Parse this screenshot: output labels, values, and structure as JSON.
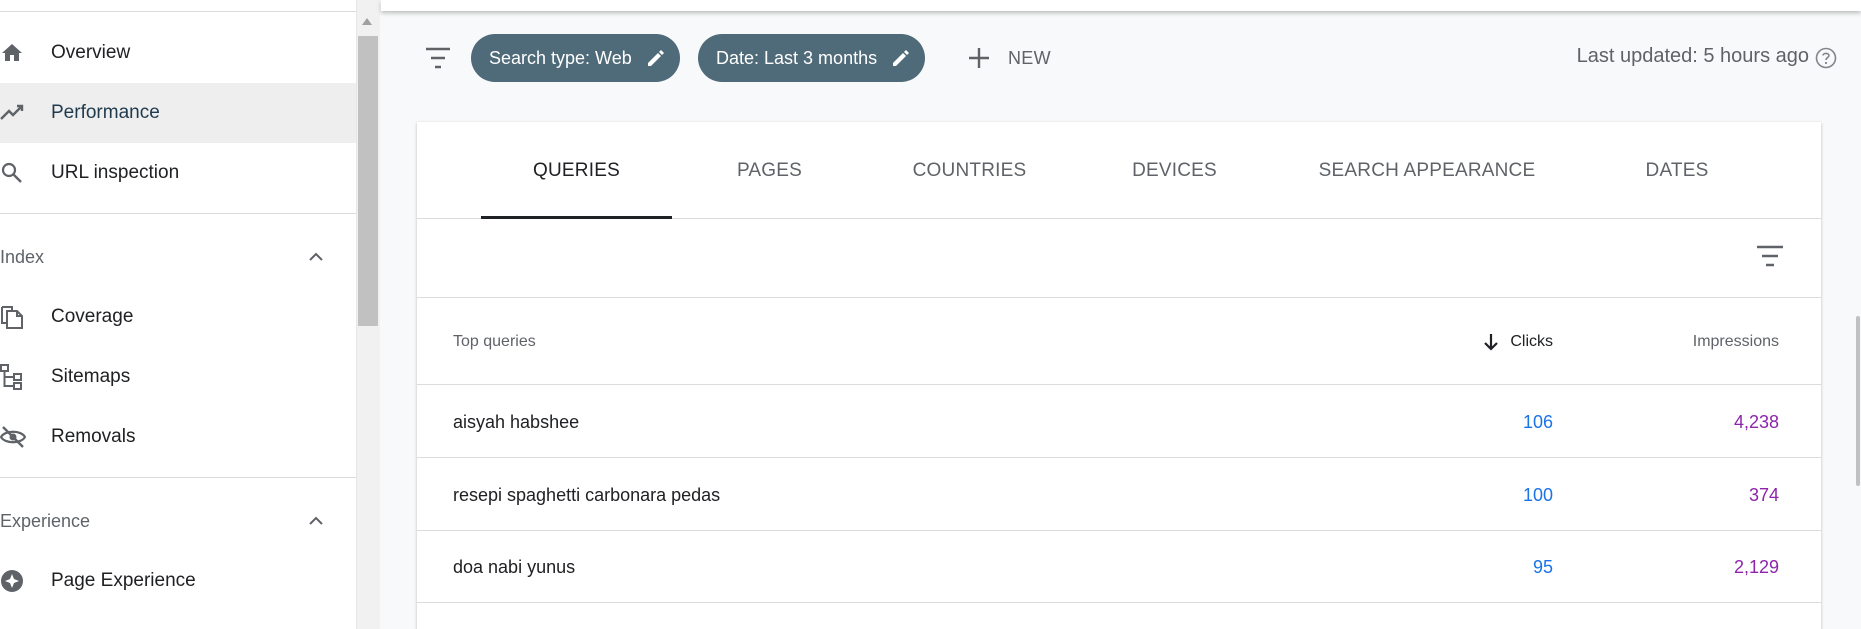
{
  "sidebar": {
    "items": [
      {
        "label": "Overview",
        "icon": "home-icon"
      },
      {
        "label": "Performance",
        "icon": "trending-up-icon",
        "active": true
      },
      {
        "label": "URL inspection",
        "icon": "search-icon"
      }
    ],
    "sections": [
      {
        "label": "Index",
        "items": [
          {
            "label": "Coverage",
            "icon": "coverage-icon"
          },
          {
            "label": "Sitemaps",
            "icon": "sitemap-icon"
          },
          {
            "label": "Removals",
            "icon": "eye-off-icon"
          }
        ]
      },
      {
        "label": "Experience",
        "items": [
          {
            "label": "Page Experience",
            "icon": "page-experience-icon"
          }
        ]
      }
    ]
  },
  "toolbar": {
    "chips": [
      {
        "label": "Search type: Web"
      },
      {
        "label": "Date: Last 3 months"
      }
    ],
    "new_label": "NEW",
    "last_updated": "Last updated: 5 hours ago"
  },
  "tabs": [
    {
      "label": "QUERIES",
      "active": true
    },
    {
      "label": "PAGES"
    },
    {
      "label": "COUNTRIES"
    },
    {
      "label": "DEVICES"
    },
    {
      "label": "SEARCH APPEARANCE"
    },
    {
      "label": "DATES"
    }
  ],
  "table": {
    "columns": {
      "query": "Top queries",
      "clicks": "Clicks",
      "impressions": "Impressions"
    },
    "sort": {
      "column": "clicks",
      "direction": "descending"
    },
    "rows": [
      {
        "query": "aisyah habshee",
        "clicks": "106",
        "impressions": "4,238"
      },
      {
        "query": "resepi spaghetti carbonara pedas",
        "clicks": "100",
        "impressions": "374"
      },
      {
        "query": "doa nabi yunus",
        "clicks": "95",
        "impressions": "2,129"
      }
    ]
  },
  "colors": {
    "chip_bg": "#4f6a78",
    "clicks": "#1a73e8",
    "impressions": "#8e24aa",
    "active_nav_bg": "#eeeeee"
  }
}
